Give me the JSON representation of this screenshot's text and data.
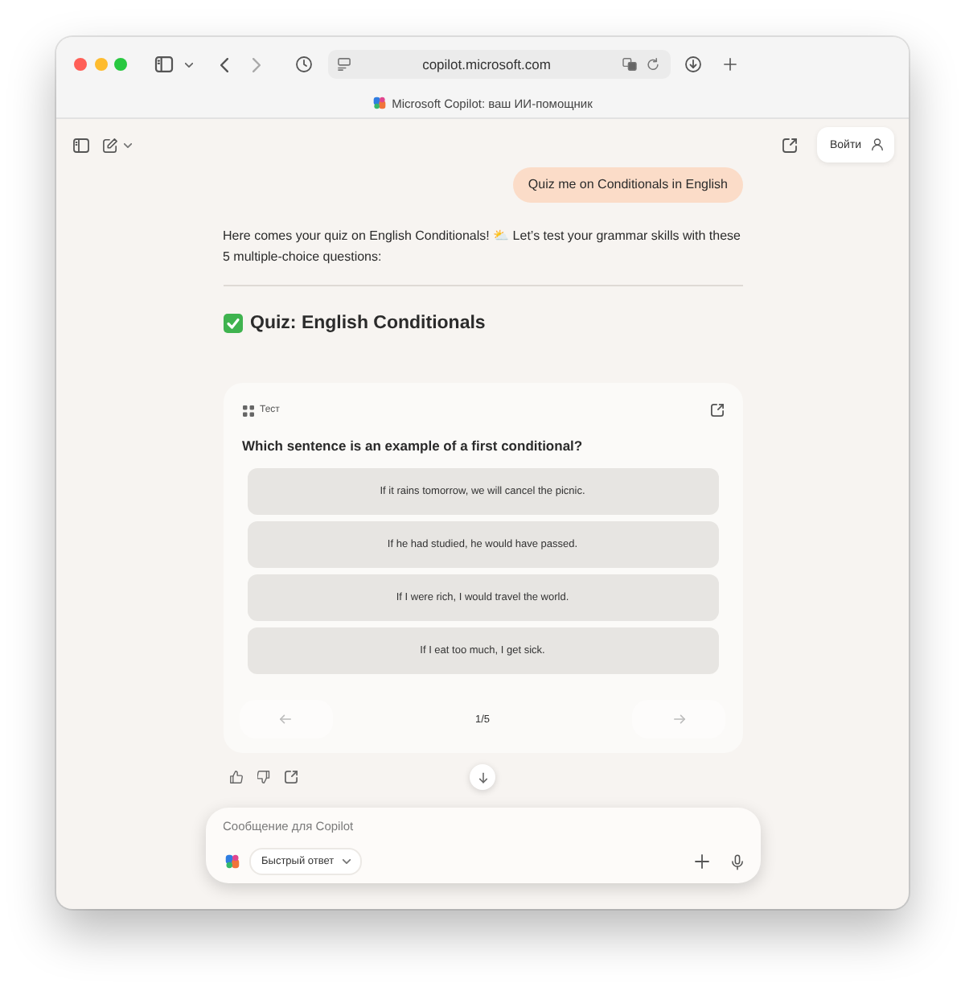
{
  "browser": {
    "url": "copilot.microsoft.com",
    "tab_title": "Microsoft Copilot: ваш ИИ-помощник"
  },
  "header": {
    "login_button": "Войти"
  },
  "conversation": {
    "user_message": "Quiz me on Conditionals in English",
    "reply_intro": "Here comes your quiz on English Conditionals! ⛅ Let’s test your grammar skills with these 5 multiple-choice questions:",
    "quiz_heading": "Quiz: English Conditionals"
  },
  "quiz_card": {
    "label": "Тест",
    "question": "Which sentence is an example of a first conditional?",
    "options": [
      {
        "text": "If it rains tomorrow, we will cancel the picnic.",
        "selected": false
      },
      {
        "text": "If he had studied, he would have passed.",
        "selected": false
      },
      {
        "text": "If I were rich, I would travel the world.",
        "selected": false
      },
      {
        "text": "If I eat too much, I get sick.",
        "selected": false
      }
    ],
    "counter": "1/5"
  },
  "composer": {
    "placeholder": "Сообщение для Copilot",
    "mode_button": "Быстрый ответ"
  }
}
